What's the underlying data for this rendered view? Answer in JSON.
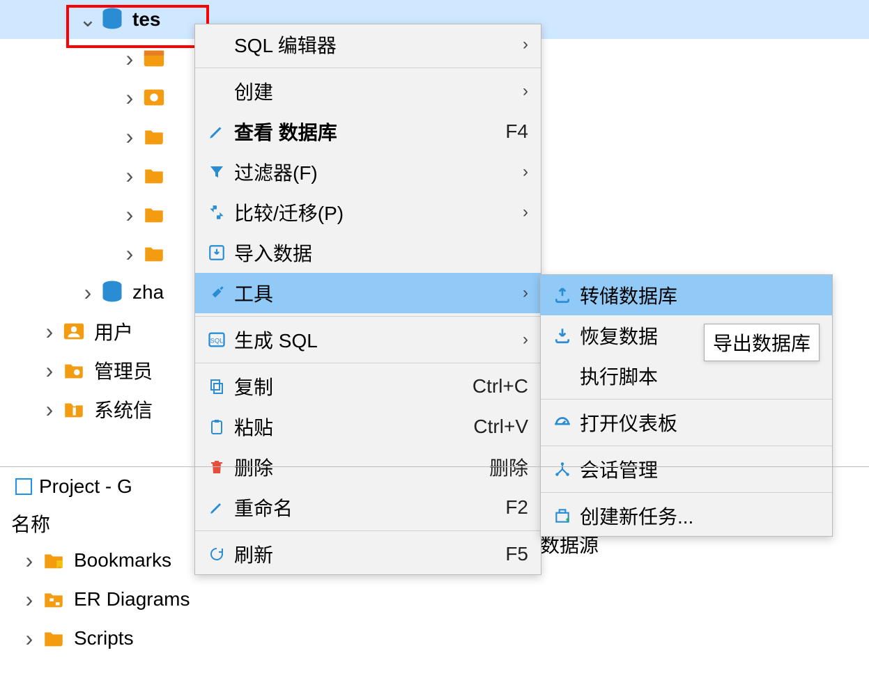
{
  "tree": {
    "selected_db": "tes",
    "zha_db": "zha",
    "users": "用户",
    "admin": "管理员",
    "sysinfo": "系统信",
    "datasource_tail": "数据源"
  },
  "menu": {
    "sql_editor": {
      "label": "SQL 编辑器",
      "sub": true
    },
    "create": {
      "label": "创建",
      "sub": true
    },
    "view_db": {
      "label": "查看 数据库",
      "short": "F4"
    },
    "filter": {
      "label": "过滤器(F)",
      "sub": true
    },
    "compare": {
      "label": "比较/迁移(P)",
      "sub": true
    },
    "import": {
      "label": "导入数据"
    },
    "tools": {
      "label": "工具",
      "sub": true
    },
    "gen_sql": {
      "label": "生成 SQL",
      "sub": true
    },
    "copy": {
      "label": "复制",
      "short": "Ctrl+C"
    },
    "paste": {
      "label": "粘贴",
      "short": "Ctrl+V"
    },
    "delete": {
      "label": "删除",
      "short": "删除"
    },
    "rename": {
      "label": "重命名",
      "short": "F2"
    },
    "refresh": {
      "label": "刷新",
      "short": "F5"
    }
  },
  "submenu": {
    "dump": {
      "label": "转储数据库"
    },
    "restore": {
      "label": "恢复数据"
    },
    "exec": {
      "label": "执行脚本"
    },
    "dashboard": {
      "label": "打开仪表板"
    },
    "session": {
      "label": "会话管理"
    },
    "newtask": {
      "label": "创建新任务..."
    }
  },
  "tooltip": "导出数据库",
  "project": {
    "title": "Project - G",
    "col": "名称",
    "bookmarks": "Bookmarks",
    "er": "ER Diagrams",
    "scripts": "Scripts"
  }
}
